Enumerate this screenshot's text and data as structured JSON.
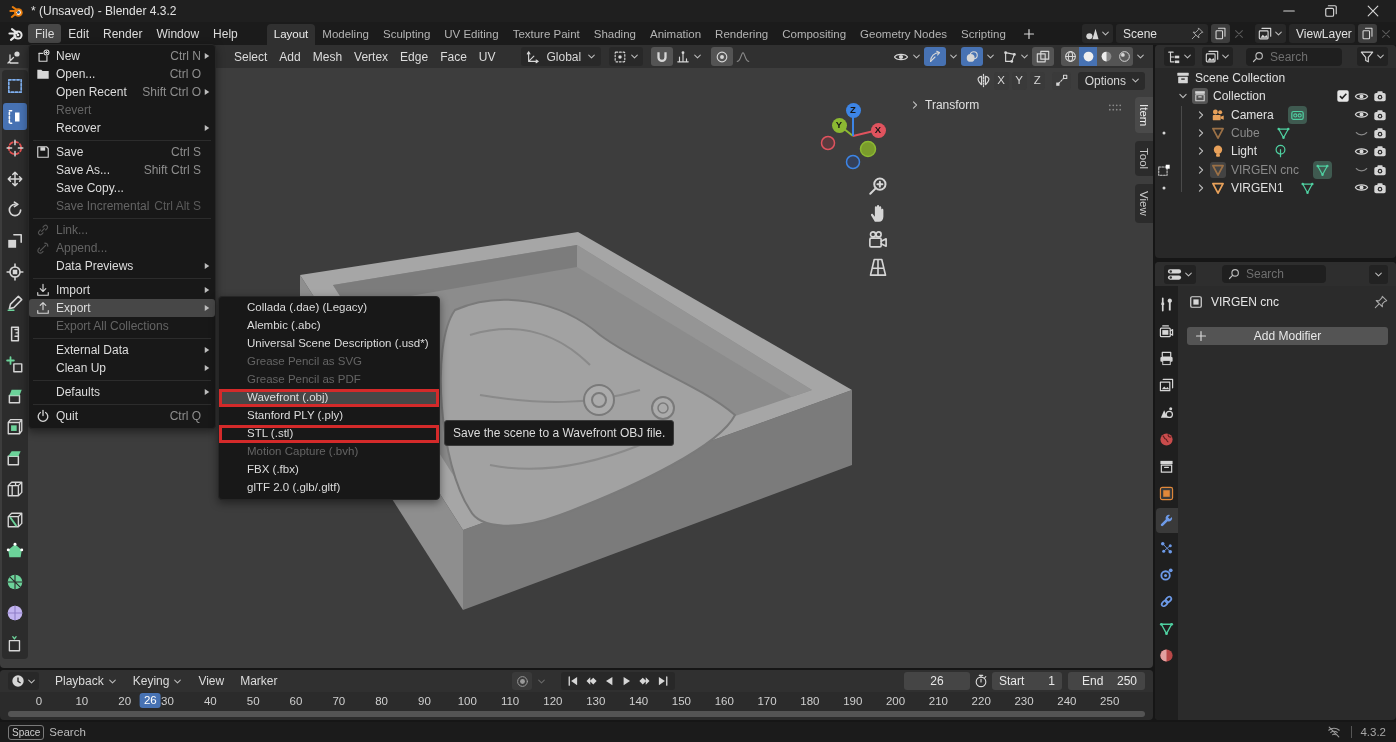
{
  "window": {
    "title": "* (Unsaved) - Blender 4.3.2"
  },
  "menu_bar": [
    {
      "label": "File",
      "selected": true
    },
    {
      "label": "Edit",
      "selected": false
    },
    {
      "label": "Render",
      "selected": false
    },
    {
      "label": "Window",
      "selected": false
    },
    {
      "label": "Help",
      "selected": false
    }
  ],
  "workspaces": [
    {
      "label": "Layout",
      "selected": true
    },
    {
      "label": "Modeling",
      "selected": false
    },
    {
      "label": "Sculpting",
      "selected": false
    },
    {
      "label": "UV Editing",
      "selected": false
    },
    {
      "label": "Texture Paint",
      "selected": false
    },
    {
      "label": "Shading",
      "selected": false
    },
    {
      "label": "Animation",
      "selected": false
    },
    {
      "label": "Rendering",
      "selected": false
    },
    {
      "label": "Compositing",
      "selected": false
    },
    {
      "label": "Geometry Nodes",
      "selected": false
    },
    {
      "label": "Scripting",
      "selected": false
    }
  ],
  "scene": {
    "value": "Scene"
  },
  "view_layer": {
    "value": "ViewLayer"
  },
  "viewport": {
    "menus": [
      "Select",
      "Add",
      "Mesh",
      "Vertex",
      "Edge",
      "Face",
      "UV"
    ],
    "orientation": "Global",
    "toggles": [
      {
        "kind": "gizmo",
        "on": true
      },
      {
        "kind": "overlay",
        "on": true
      },
      {
        "kind": "xray",
        "on": false
      }
    ],
    "shading": [
      {
        "kind": "wireframe",
        "selected": false
      },
      {
        "kind": "solid",
        "selected": true
      },
      {
        "kind": "material",
        "selected": false
      },
      {
        "kind": "rendered",
        "selected": false
      }
    ],
    "mirror_axes": [
      "X",
      "Y",
      "Z"
    ],
    "options": "Options",
    "tools": [
      {
        "kind": "select-box",
        "selected": false
      },
      {
        "kind": "tweak",
        "selected": true
      },
      {
        "kind": "cursor",
        "selected": false
      },
      {
        "kind": "move",
        "selected": false
      },
      {
        "kind": "rotate",
        "selected": false
      },
      {
        "kind": "scale",
        "selected": false
      },
      {
        "kind": "transform",
        "selected": false
      },
      {
        "kind": "annotate",
        "selected": false
      },
      {
        "kind": "measure",
        "selected": false
      },
      {
        "kind": "add-cube",
        "selected": false
      },
      {
        "kind": "extrude",
        "selected": false
      },
      {
        "kind": "inset",
        "selected": false
      },
      {
        "kind": "bevel",
        "selected": false
      },
      {
        "kind": "loop-cut",
        "selected": false
      },
      {
        "kind": "knife",
        "selected": false
      },
      {
        "kind": "poly-build",
        "selected": false
      },
      {
        "kind": "spin",
        "selected": false
      },
      {
        "kind": "smooth",
        "selected": false
      },
      {
        "kind": "shrink",
        "selected": false
      }
    ],
    "gizmo_axes": [
      "X",
      "Y",
      "Z"
    ],
    "panel": "Transform",
    "sidebar_tabs": [
      {
        "label": "Item",
        "selected": true
      },
      {
        "label": "Tool",
        "selected": false
      },
      {
        "label": "View",
        "selected": false
      }
    ]
  },
  "file_menu": {
    "groups": [
      {
        "items": [
          {
            "label": "New",
            "kind": "new",
            "shortcut": "Ctrl N",
            "submenu": true,
            "disabled": false,
            "selected": false
          },
          {
            "label": "Open...",
            "kind": "open",
            "shortcut": "Ctrl O",
            "submenu": false,
            "disabled": false,
            "selected": false
          },
          {
            "label": "Open Recent",
            "kind": "plain",
            "shortcut": "Shift Ctrl O",
            "submenu": true,
            "disabled": false,
            "selected": false
          },
          {
            "label": "Revert",
            "kind": "plain",
            "submenu": false,
            "disabled": true,
            "selected": false
          },
          {
            "label": "Recover",
            "kind": "plain",
            "submenu": true,
            "disabled": false,
            "selected": false
          }
        ]
      },
      {
        "items": [
          {
            "label": "Save",
            "kind": "save",
            "shortcut": "Ctrl S",
            "submenu": false,
            "disabled": false,
            "selected": false
          },
          {
            "label": "Save As...",
            "kind": "plain",
            "shortcut": "Shift Ctrl S",
            "submenu": false,
            "disabled": false,
            "selected": false
          },
          {
            "label": "Save Copy...",
            "kind": "plain",
            "submenu": false,
            "disabled": false,
            "selected": false
          },
          {
            "label": "Save Incremental",
            "kind": "plain",
            "shortcut": "Ctrl Alt S",
            "submenu": false,
            "disabled": true,
            "selected": false
          }
        ]
      },
      {
        "items": [
          {
            "label": "Link...",
            "kind": "link",
            "submenu": false,
            "disabled": true,
            "selected": false
          },
          {
            "label": "Append...",
            "kind": "append",
            "submenu": false,
            "disabled": true,
            "selected": false
          },
          {
            "label": "Data Previews",
            "kind": "plain",
            "submenu": true,
            "disabled": false,
            "selected": false
          }
        ]
      },
      {
        "items": [
          {
            "label": "Import",
            "kind": "import",
            "submenu": true,
            "disabled": false,
            "selected": false
          },
          {
            "label": "Export",
            "kind": "export",
            "submenu": true,
            "disabled": false,
            "selected": true
          },
          {
            "label": "Export All Collections",
            "kind": "plain",
            "submenu": false,
            "disabled": true,
            "selected": false
          }
        ]
      },
      {
        "items": [
          {
            "label": "External Data",
            "kind": "plain",
            "submenu": true,
            "disabled": false,
            "selected": false
          },
          {
            "label": "Clean Up",
            "kind": "plain",
            "submenu": true,
            "disabled": false,
            "selected": false
          }
        ]
      },
      {
        "items": [
          {
            "label": "Defaults",
            "kind": "plain",
            "submenu": true,
            "disabled": false,
            "selected": false
          }
        ]
      },
      {
        "items": [
          {
            "label": "Quit",
            "kind": "quit",
            "shortcut": "Ctrl Q",
            "submenu": false,
            "disabled": false,
            "selected": false
          }
        ]
      }
    ]
  },
  "export_menu": {
    "items": [
      {
        "label": "Collada (.dae) (Legacy)",
        "disabled": false,
        "selected": false,
        "annotated": false
      },
      {
        "label": "Alembic (.abc)",
        "disabled": false,
        "selected": false,
        "annotated": false
      },
      {
        "label": "Universal Scene Description (.usd*)",
        "disabled": false,
        "selected": false,
        "annotated": false
      },
      {
        "label": "Grease Pencil as SVG",
        "disabled": true,
        "selected": false,
        "annotated": false
      },
      {
        "label": "Grease Pencil as PDF",
        "disabled": true,
        "selected": false,
        "annotated": false
      },
      {
        "label": "Wavefront (.obj)",
        "disabled": false,
        "selected": true,
        "annotated": true
      },
      {
        "label": "Stanford PLY (.ply)",
        "disabled": false,
        "selected": false,
        "annotated": false
      },
      {
        "label": "STL (.stl)",
        "disabled": false,
        "selected": false,
        "annotated": true
      },
      {
        "label": "Motion Capture (.bvh)",
        "disabled": true,
        "selected": false,
        "annotated": false
      },
      {
        "label": "FBX (.fbx)",
        "disabled": false,
        "selected": false,
        "annotated": false
      },
      {
        "label": "glTF 2.0 (.glb/.gltf)",
        "disabled": false,
        "selected": false,
        "annotated": false
      }
    ]
  },
  "tooltip": "Save the scene to a Wavefront OBJ file.",
  "outliner": {
    "search_placeholder": "Search",
    "tree": [
      {
        "label": "Scene Collection",
        "kind": "scene-collection",
        "children": [
          {
            "label": "Collection",
            "kind": "collection",
            "expanded": true,
            "checked": true,
            "hidden": false,
            "children": [
              {
                "label": "Camera",
                "kind": "camera",
                "expanded": false,
                "hidden": false,
                "active": false,
                "data_active": true
              },
              {
                "label": "Cube",
                "kind": "mesh",
                "expanded": false,
                "hidden": true,
                "active": false,
                "data_active": false,
                "can_edit": true
              },
              {
                "label": "Light",
                "kind": "light",
                "expanded": false,
                "hidden": false,
                "active": false,
                "data_active": false
              },
              {
                "label": "VIRGEN cnc",
                "kind": "mesh",
                "expanded": false,
                "hidden": true,
                "active": true,
                "data_active": true,
                "in_edit_mode": true
              },
              {
                "label": "VIRGEN1",
                "kind": "mesh",
                "expanded": false,
                "hidden": false,
                "active": false,
                "data_active": false,
                "can_edit": true
              }
            ]
          }
        ]
      }
    ]
  },
  "properties": {
    "search_placeholder": "Search",
    "tabs": [
      {
        "kind": "tool",
        "selected": false
      },
      {
        "kind": "render",
        "selected": false
      },
      {
        "kind": "output",
        "selected": false
      },
      {
        "kind": "view-layer",
        "selected": false
      },
      {
        "kind": "scene",
        "selected": false
      },
      {
        "kind": "world",
        "selected": false
      },
      {
        "kind": "collection",
        "selected": false
      },
      {
        "kind": "object",
        "selected": false
      },
      {
        "kind": "modifiers",
        "selected": true
      },
      {
        "kind": "particles",
        "selected": false
      },
      {
        "kind": "physics",
        "selected": false
      },
      {
        "kind": "constraints",
        "selected": false
      },
      {
        "kind": "data",
        "selected": false
      },
      {
        "kind": "material",
        "selected": false
      }
    ],
    "object_name": "VIRGEN cnc",
    "add_button": "Add Modifier"
  },
  "timeline": {
    "menus": [
      {
        "label": "Playback",
        "dropdown": true
      },
      {
        "label": "Keying",
        "dropdown": true
      },
      {
        "label": "View",
        "dropdown": false
      },
      {
        "label": "Marker",
        "dropdown": false
      }
    ],
    "current_frame": "26",
    "start_label": "Start",
    "start": "1",
    "end_label": "End",
    "end": "250",
    "ticks": [
      "0",
      "10",
      "20",
      "30",
      "40",
      "50",
      "60",
      "70",
      "80",
      "90",
      "100",
      "110",
      "120",
      "130",
      "140",
      "150",
      "160",
      "170",
      "180",
      "190",
      "200",
      "210",
      "220",
      "230",
      "240",
      "250"
    ],
    "playhead": {
      "frame": "26",
      "level": 0.104
    }
  },
  "status_bar": {
    "key": "Space",
    "action": "Search",
    "version": "4.3.2"
  }
}
